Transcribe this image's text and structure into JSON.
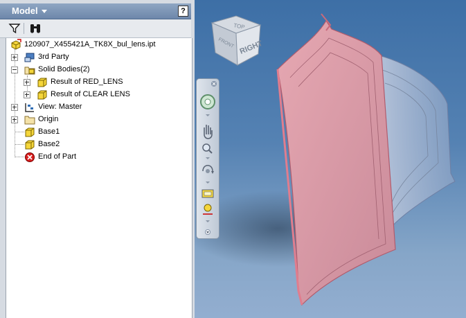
{
  "panel": {
    "title": "Model",
    "help_label": "?"
  },
  "toolbar": {
    "filter_icon": "filter-icon",
    "find_icon": "binoculars-icon"
  },
  "tree": {
    "root": "120907_X455421A_TK8X_bul_lens.ipt",
    "items": [
      {
        "label": "3rd Party",
        "icon": "third-party-icon",
        "expander": "plus"
      },
      {
        "label": "Solid Bodies(2)",
        "icon": "solid-bodies-icon",
        "expander": "minus"
      },
      {
        "label": "Result of RED_LENS",
        "icon": "solid-body-icon",
        "expander": "plus"
      },
      {
        "label": "Result of CLEAR LENS",
        "icon": "solid-body-icon",
        "expander": "plus"
      },
      {
        "label": "View: Master",
        "icon": "view-rep-icon",
        "expander": "plus"
      },
      {
        "label": "Origin",
        "icon": "folder-icon",
        "expander": "plus"
      },
      {
        "label": "Base1",
        "icon": "body-feature-icon"
      },
      {
        "label": "Base2",
        "icon": "body-feature-icon"
      },
      {
        "label": "End of Part",
        "icon": "end-of-part-icon"
      }
    ]
  },
  "viewcube": {
    "top_label": "TOP",
    "right_label": "RIGHT",
    "front_label": "FRONT"
  },
  "colors": {
    "panel_header": "#7b93b5",
    "viewport_top": "#3d6fa6",
    "viewport_bottom": "#93aed0",
    "red_lens": "#d9707c"
  }
}
